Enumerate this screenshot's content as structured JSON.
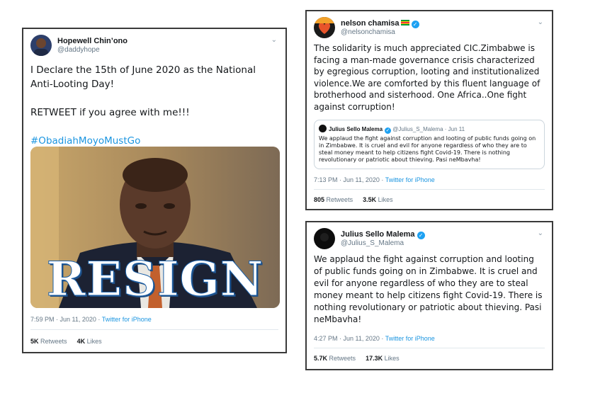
{
  "tweet1": {
    "name": "Hopewell Chin’ono",
    "handle": "@daddyhope",
    "text": "I Declare the 15th of June 2020 as the National Anti-Looting Day!\n\nRETWEET if you agree with me!!!",
    "hashtag": "#ObadiahMoyoMustGo",
    "image_text": "RESIGN",
    "time": "7:59 PM · Jun 11, 2020 · ",
    "source": "Twitter for iPhone",
    "retweets": "5K",
    "retweets_label": "Retweets",
    "likes": "4K",
    "likes_label": "Likes"
  },
  "tweet2": {
    "name": "nelson chamisa",
    "handle": "@nelsonchamisa",
    "text": "The solidarity is much appreciated CIC.Zimbabwe is facing a man-made governance crisis characterized by egregious corruption, looting and institutionalized violence.We are comforted by this fluent language of brotherhood and sisterhood. One Africa..One fight against corruption!",
    "quote": {
      "name": "Julius Sello Malema",
      "handle": "@Julius_S_Malema · Jun 11",
      "text": "We applaud the fight against corruption and looting of public funds going on in Zimbabwe. It is cruel and evil for anyone regardless of who they are to steal money meant to help citizens fight Covid-19. There is nothing revolutionary or patriotic about thieving. Pasi neMbavha!"
    },
    "time": "7:13 PM · Jun 11, 2020 · ",
    "source": "Twitter for iPhone",
    "retweets": "805",
    "retweets_label": "Retweets",
    "likes": "3.5K",
    "likes_label": "Likes"
  },
  "tweet3": {
    "name": "Julius Sello Malema",
    "handle": "@Julius_S_Malema",
    "text": "We applaud the fight against corruption and looting of public funds going on in Zimbabwe. It is cruel and evil for anyone regardless of who they are to steal money meant to help citizens fight Covid-19. There is nothing revolutionary or patriotic about thieving. Pasi neMbavha!",
    "time": "4:27 PM · Jun 11, 2020 · ",
    "source": "Twitter for iPhone",
    "retweets": "5.7K",
    "retweets_label": "Retweets",
    "likes": "17.3K",
    "likes_label": "Likes"
  },
  "icons": {
    "chevron": "chevron-down-icon",
    "verified": "verified-badge-icon",
    "flag": "zimbabwe-flag-emoji"
  },
  "colors": {
    "link": "#1b95e0",
    "verified": "#1da1f2",
    "muted": "#657786"
  }
}
